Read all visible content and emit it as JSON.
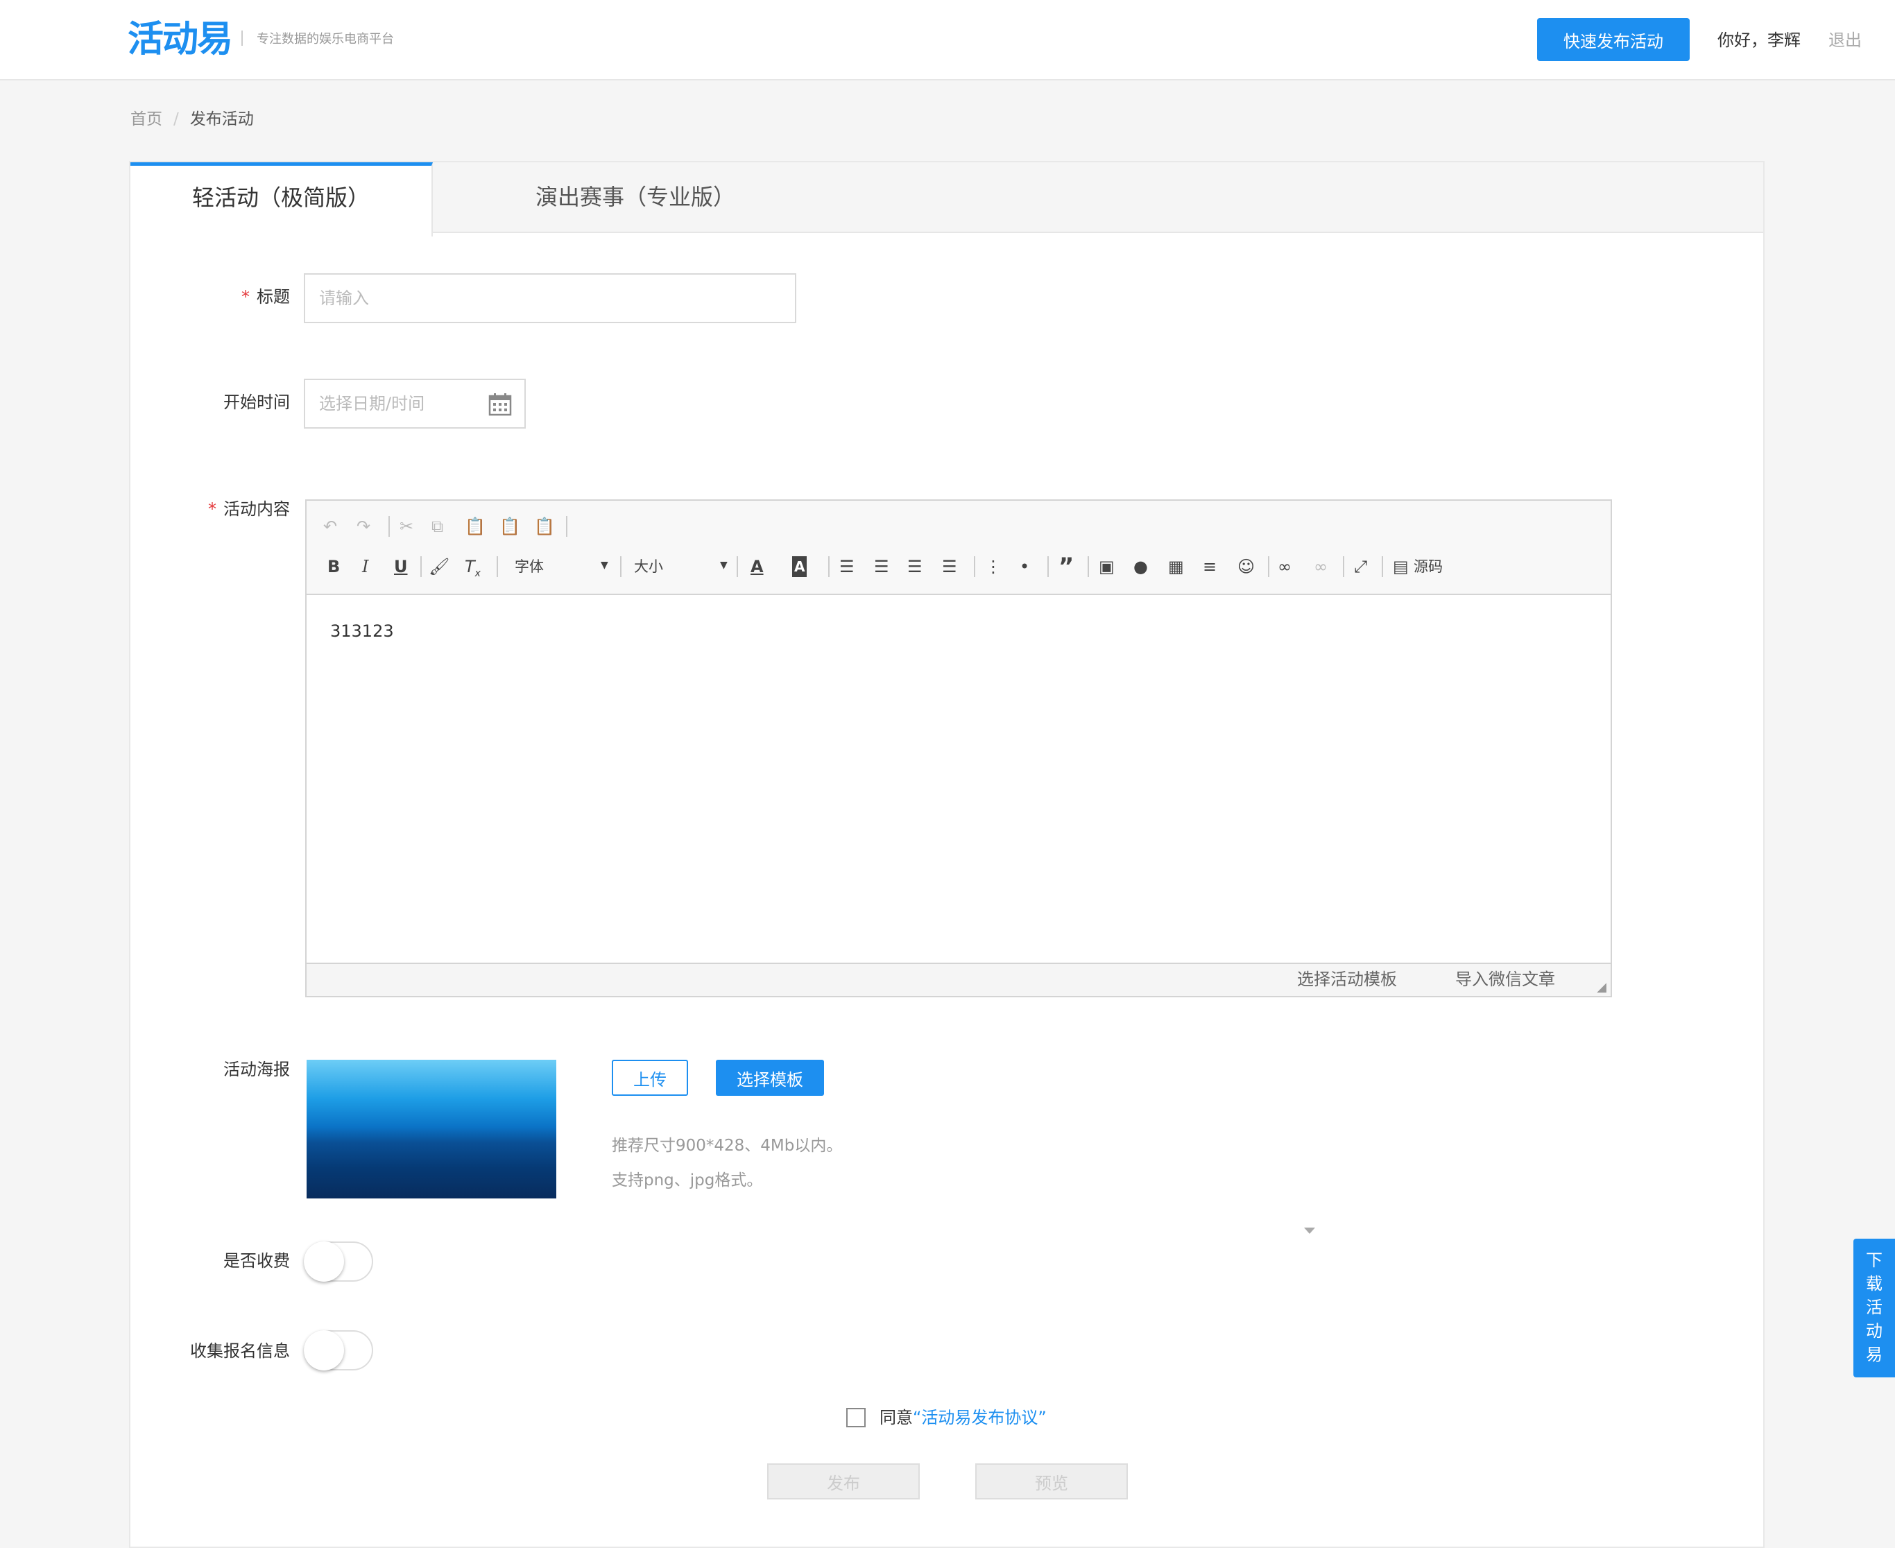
{
  "header": {
    "logo": "活动易",
    "slogan": "专注数据的娱乐电商平台",
    "quick_publish": "快速发布活动",
    "greeting": "你好，李辉",
    "logout": "退出"
  },
  "breadcrumb": {
    "home": "首页",
    "separator": "/",
    "current": "发布活动"
  },
  "tabs": [
    {
      "label": "轻活动（极简版）",
      "active": true
    },
    {
      "label": "演出赛事（专业版）",
      "active": false
    }
  ],
  "form": {
    "title_label": "标题",
    "title_placeholder": "请输入",
    "start_label": "开始时间",
    "start_placeholder": "选择日期/时间",
    "content_label": "活动内容",
    "poster_label": "活动海报",
    "fee_label": "是否收费",
    "collect_label": "收集报名信息",
    "required_mark": "*"
  },
  "editor": {
    "font_label": "字体",
    "size_label": "大小",
    "source_label": "源码",
    "content": "313123",
    "footer_template": "选择活动模板",
    "footer_wechat": "导入微信文章"
  },
  "poster": {
    "upload": "上传",
    "choose_template": "选择模板",
    "hint1": "推荐尺寸900*428、4Mb以内。",
    "hint2": "支持png、jpg格式。"
  },
  "switches": {
    "fee_on": false,
    "collect_on": false
  },
  "agreement": {
    "prefix": "同意",
    "link": "“活动易发布协议”",
    "checked": false
  },
  "actions": {
    "publish": "发布",
    "preview": "预览"
  },
  "side": {
    "download": "下载活动易"
  },
  "colors": {
    "accent": "#1d8ff0",
    "required": "#e4393c"
  }
}
